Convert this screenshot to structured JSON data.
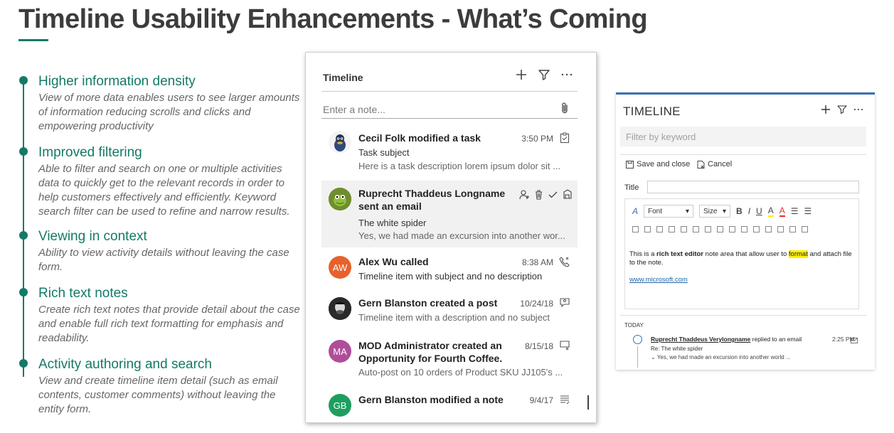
{
  "slide": {
    "title": "Timeline Usability Enhancements - What’s Coming"
  },
  "features": [
    {
      "title": "Higher information density",
      "desc": "View of more data enables users to see larger amounts of information reducing scrolls and clicks and empowering productivity"
    },
    {
      "title": "Improved filtering",
      "desc": "Able to filter and search on one or multiple activities data to quickly get to the relevant records in order to help customers effectively and efficiently. Keyword search filter can be used to refine and narrow results."
    },
    {
      "title": "Viewing in context",
      "desc": "Ability to view activity details without leaving the case form."
    },
    {
      "title": "Rich text notes",
      "desc": "Create rich text notes that provide detail about the case and enable full rich text formatting for emphasis and readability."
    },
    {
      "title": "Activity authoring and search",
      "desc": "View and create timeline item detail (such as email contents, customer comments) without leaving the entity form."
    }
  ],
  "timeline_new": {
    "title": "Timeline",
    "note_placeholder": "Enter a note...",
    "items": [
      {
        "title": "Cecil Folk modified a task",
        "date": "3:50 PM",
        "subject": "Task subject",
        "desc": "Here is a task description lorem ipsum dolor sit ...",
        "icon": "task-icon"
      },
      {
        "title_line1": "Ruprecht Thaddeus Longname",
        "title_line2": "sent an email",
        "subject": "The white spider",
        "desc": "Yes, we had made an excursion into another wor...",
        "icon": "email-icon"
      },
      {
        "initials": "AW",
        "avatar_color": "#e8612c",
        "title": "Alex Wu called",
        "date": "8:38 AM",
        "subject": "Timeline item with subject and no description",
        "icon": "phone-icon"
      },
      {
        "title": "Gern Blanston created a post",
        "date": "10/24/18",
        "desc": "Timeline item with a description and no subject",
        "icon": "post-icon"
      },
      {
        "initials": "MA",
        "avatar_color": "#b04d99",
        "title_line1": "MOD Administrator created an",
        "title_line2": "Opportunity for  Fourth Coffee.",
        "date": "8/15/18",
        "desc": "Auto-post on 10 orders of Product SKU JJ105's ...",
        "icon": "auto-post-icon"
      },
      {
        "initials": "GB",
        "avatar_color": "#1e9e5e",
        "title": "Gern Blanston modified a note",
        "date": "9/4/17",
        "icon": "note-icon"
      }
    ]
  },
  "timeline_old": {
    "title": "TIMELINE",
    "filter_placeholder": "Filter by keyword",
    "save_close_label": "Save and close",
    "cancel_label": "Cancel",
    "title_label": "Title",
    "font_label": "Font",
    "size_label": "Size",
    "editor_text_1": "This is a ",
    "editor_text_bold": "rich text editor",
    "editor_text_2": " note area that allow user to ",
    "editor_text_hl": "format",
    "editor_text_3": " and attach file to the note.",
    "editor_link": "www.microsoft.com",
    "today_label": "TODAY",
    "item": {
      "author": "Ruprecht Thaddeus Verylongname",
      "action": " replied to an email",
      "time": "2:25 PM",
      "subject": "Re: The white spider",
      "desc": "Yes, we had made an excursion into another world ..."
    }
  },
  "colors": {
    "accent_green": "#137a66",
    "accent_blue": "#3b6fb6",
    "highlight": "#ffef00"
  }
}
